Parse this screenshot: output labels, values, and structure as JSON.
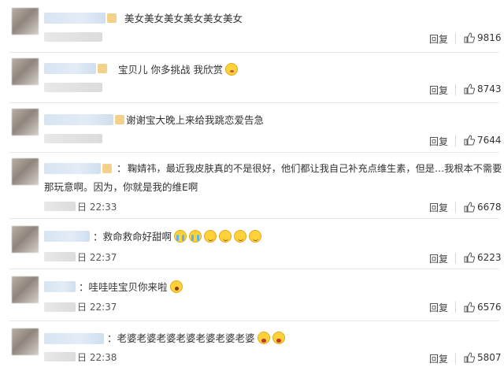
{
  "actions": {
    "reply_label": "回复"
  },
  "comments": [
    {
      "text": "美女美女美女美女美女美女",
      "time": "",
      "likes": "9816",
      "emojis": []
    },
    {
      "text": "宝贝儿 你多挑战 我欣赏",
      "time": "",
      "likes": "8743",
      "emojis": [
        "kiss"
      ]
    },
    {
      "text": "谢谢宝大晚上来给我跳恋爱告急",
      "time": "",
      "likes": "7644",
      "emojis": []
    },
    {
      "text_line1": "鞠婧祎，最近我皮肤真的不是很好，他们都让我自己补充点维生素，但是…我根本不需要",
      "text_line2": "那玩意啊。因为，你就是我的维E啊",
      "time": "日 22:33",
      "likes": "6678",
      "emojis": []
    },
    {
      "text": "救命救命好甜啊",
      "time": "日 22:37",
      "likes": "6223",
      "emojis": [
        "cry",
        "cry",
        "smile",
        "smile",
        "smile",
        "smile"
      ]
    },
    {
      "text": "哇哇哇宝贝你来啦",
      "time": "日 22:37",
      "likes": "6576",
      "emojis": [
        "wow"
      ]
    },
    {
      "text": "老婆老婆老婆老婆老婆老婆老婆",
      "time": "日 22:38",
      "likes": "5807",
      "emojis": [
        "scared",
        "scared"
      ]
    }
  ],
  "separator": "：",
  "icons": {
    "like": "thumbs-up-icon",
    "emoji": "emoji-icon"
  },
  "colors": {
    "username_blur": "#d7e4f2",
    "text": "#333333",
    "divider": "#e9e9e9"
  }
}
